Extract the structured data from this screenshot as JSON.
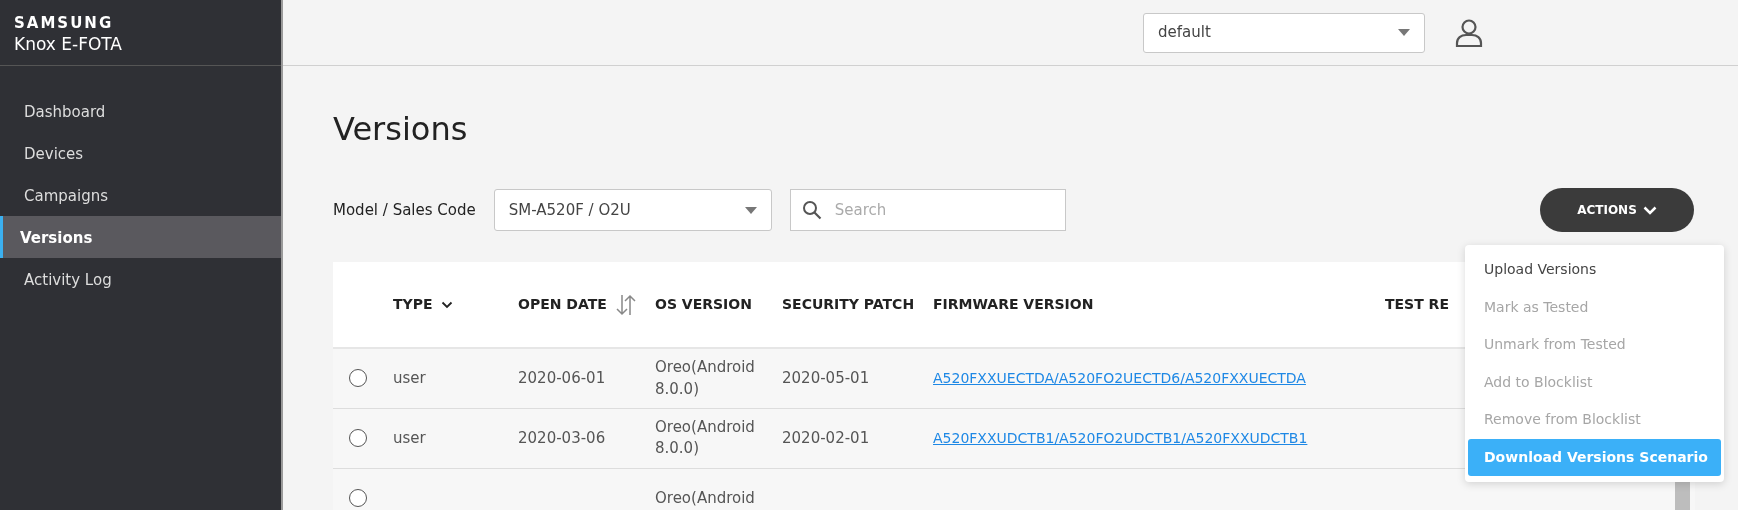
{
  "brand": {
    "company": "SAMSUNG",
    "product": "Knox E-FOTA"
  },
  "sidebar": {
    "items": [
      {
        "label": "Dashboard",
        "selected": false
      },
      {
        "label": "Devices",
        "selected": false
      },
      {
        "label": "Campaigns",
        "selected": false
      },
      {
        "label": "Versions",
        "selected": true
      },
      {
        "label": "Activity Log",
        "selected": false
      }
    ]
  },
  "header": {
    "workspace_select": {
      "value": "default"
    }
  },
  "page": {
    "title": "Versions"
  },
  "filters": {
    "model_label": "Model / Sales Code",
    "model_select": {
      "value": "SM-A520F / O2U"
    },
    "search": {
      "placeholder": "Search"
    },
    "actions_button": "ACTIONS"
  },
  "table": {
    "columns": [
      {
        "label": "TYPE",
        "kind": "dropdown"
      },
      {
        "label": "OPEN DATE",
        "kind": "sortable"
      },
      {
        "label": "OS VERSION",
        "kind": "plain"
      },
      {
        "label": "SECURITY PATCH",
        "kind": "plain"
      },
      {
        "label": "FIRMWARE VERSION",
        "kind": "plain"
      },
      {
        "label": "TEST RE",
        "kind": "plain"
      }
    ],
    "rows": [
      {
        "selected": false,
        "type": "user",
        "open_date": "2020-06-01",
        "os_version": "Oreo(Android 8.0.0)",
        "security_patch": "2020-05-01",
        "firmware_version": "A520FXXUECTDA/A520FO2UECTD6/A520FXXUECTDA"
      },
      {
        "selected": false,
        "type": "user",
        "open_date": "2020-03-06",
        "os_version": "Oreo(Android 8.0.0)",
        "security_patch": "2020-02-01",
        "firmware_version": "A520FXXUDCTB1/A520FO2UDCTB1/A520FXXUDCTB1"
      },
      {
        "selected": false,
        "os_version": "Oreo(Android"
      }
    ]
  },
  "actions_menu": {
    "items": [
      {
        "label": "Upload Versions",
        "disabled": false,
        "highlighted": false
      },
      {
        "label": "Mark as Tested",
        "disabled": true,
        "highlighted": false
      },
      {
        "label": "Unmark from Tested",
        "disabled": true,
        "highlighted": false
      },
      {
        "label": "Add to Blocklist",
        "disabled": true,
        "highlighted": false
      },
      {
        "label": "Remove from Blocklist",
        "disabled": true,
        "highlighted": false
      },
      {
        "label": "Download Versions Scenario",
        "disabled": false,
        "highlighted": true
      }
    ]
  }
}
